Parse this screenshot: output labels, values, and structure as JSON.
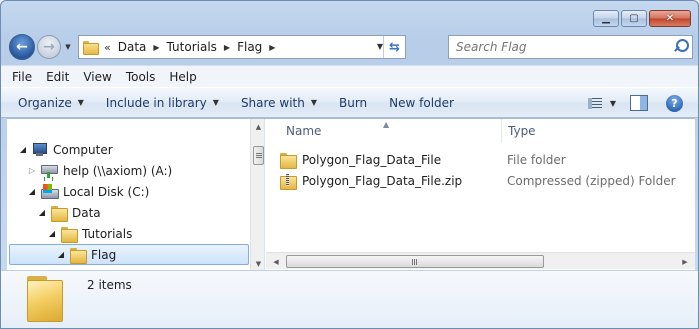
{
  "window": {
    "caption_buttons": [
      {
        "name": "minimize-button",
        "glyph": "▁"
      },
      {
        "name": "maximize-button",
        "glyph": "▢"
      },
      {
        "name": "close-button",
        "glyph": "✕"
      }
    ]
  },
  "navigation": {
    "back_icon": "back-arrow-icon",
    "forward_icon": "forward-arrow-icon",
    "breadcrumb_prefix": "«",
    "breadcrumbs": [
      "Data",
      "Tutorials",
      "Flag"
    ],
    "search_placeholder": "Search Flag"
  },
  "menubar": {
    "items": [
      "File",
      "Edit",
      "View",
      "Tools",
      "Help"
    ]
  },
  "toolbar": {
    "organize": "Organize",
    "include_in_library": "Include in library",
    "share_with": "Share with",
    "burn": "Burn",
    "new_folder": "New folder"
  },
  "tree": {
    "items": [
      {
        "label": "Computer",
        "icon": "computer-icon",
        "expanded": true
      },
      {
        "label": "help (\\\\axiom) (A:)",
        "icon": "network-drive-icon",
        "expanded": false
      },
      {
        "label": "Local Disk (C:)",
        "icon": "local-disk-icon",
        "expanded": true
      },
      {
        "label": "Data",
        "icon": "folder-icon",
        "expanded": true
      },
      {
        "label": "Tutorials",
        "icon": "folder-icon",
        "expanded": true
      },
      {
        "label": "Flag",
        "icon": "folder-icon",
        "expanded": true,
        "selected": true
      }
    ]
  },
  "columns": {
    "name": "Name",
    "type": "Type"
  },
  "files": [
    {
      "name": "Polygon_Flag_Data_File",
      "type": "File folder",
      "icon": "folder-icon"
    },
    {
      "name": "Polygon_Flag_Data_File.zip",
      "type": "Compressed (zipped) Folder",
      "icon": "zip-folder-icon"
    }
  ],
  "details": {
    "item_count": "2 items"
  },
  "colors": {
    "accent": "#3a74c4",
    "selection_border": "#84acdd",
    "toolbar_text": "#1e3a66"
  }
}
